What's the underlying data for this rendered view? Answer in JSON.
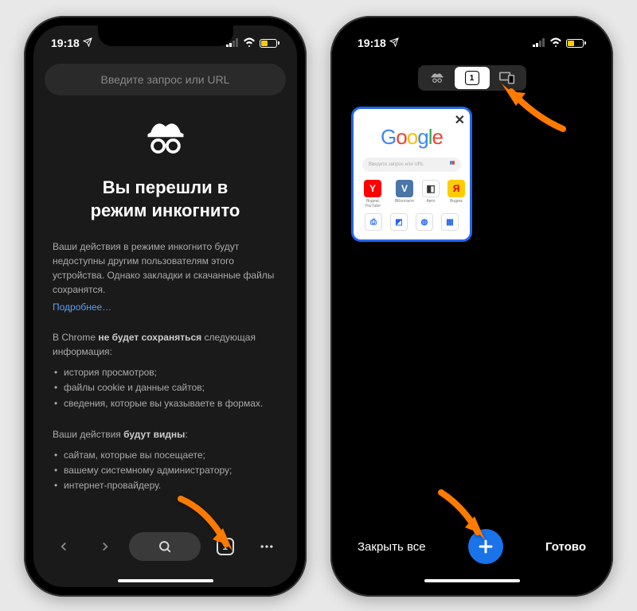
{
  "status": {
    "time": "19:18"
  },
  "screen1": {
    "address_placeholder": "Введите запрос или URL",
    "title": "Вы перешли в\nрежим инкогнито",
    "description": "Ваши действия в режиме инкогнито будут недоступны другим пользователям этого устройства. Однако закладки и скачанные файлы сохранятся.",
    "learn_more": "Подробнее…",
    "not_saved_heading_pre": "В Chrome ",
    "not_saved_heading_strong": "не будет сохраняться",
    "not_saved_heading_post": " следующая информация:",
    "not_saved_items": [
      "история просмотров;",
      "файлы cookie и данные сайтов;",
      "сведения, которые вы указываете в формах."
    ],
    "visible_heading_pre": "Ваши действия ",
    "visible_heading_strong": "будут видны",
    "visible_heading_post": ":",
    "visible_items": [
      "сайтам, которые вы посещаете;",
      "вашему системному администратору;",
      "интернет-провайдеру."
    ],
    "tab_count": "1"
  },
  "screen2": {
    "tab_count": "1",
    "google_logo": [
      "G",
      "o",
      "o",
      "g",
      "l",
      "e"
    ],
    "search_placeholder": "Введите запрос или URL",
    "shortcuts_row1": [
      {
        "label": "Яндекс YouTube",
        "bg": "#ff0000",
        "letter": "Y"
      },
      {
        "label": "ВКонтакте",
        "bg": "#4a76a8",
        "letter": "V"
      },
      {
        "label": "Авто",
        "bg": "#ffffff",
        "letter": "◧",
        "fg": "#333"
      },
      {
        "label": "Яндекс",
        "bg": "#ffcc00",
        "letter": "Я",
        "fg": "#d00"
      }
    ],
    "close_all": "Закрыть все",
    "done": "Готово"
  },
  "colors": {
    "accent": "#1a73e8",
    "arrow": "#ff7a00"
  }
}
